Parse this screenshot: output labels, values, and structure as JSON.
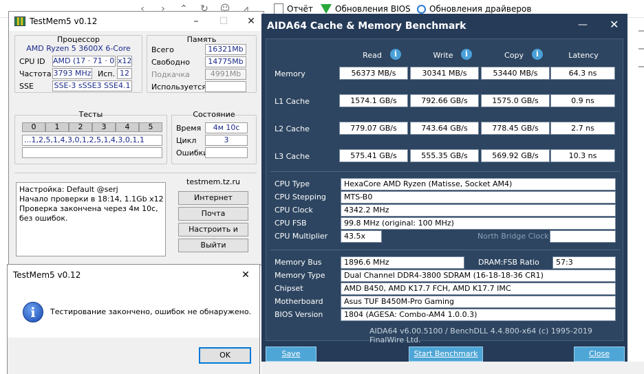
{
  "background_toolbar": {
    "report": "Отчёт",
    "bios_updates": "Обновления BIOS",
    "driver_updates": "Обновления драйверов"
  },
  "testmem": {
    "title": "TestMem5 v0.12",
    "processor_title": "Процессор",
    "cpu_name": "AMD Ryzen 5 3600X 6-Core",
    "cpu_id_label": "CPU ID",
    "cpu_id_value": "AMD  (17 · 71 · 0)",
    "cpu_threads": "x12",
    "freq_label": "Частота",
    "freq_value": "3793 MHz",
    "used_threads_label": "Исп.",
    "used_threads_value": "12",
    "sse_label": "SSE",
    "sse_value": "SSE-3 sSSE3 SSE4.1",
    "memory_title": "Память",
    "total_label": "Всего",
    "total_value": "16321Mb",
    "free_label": "Свободно",
    "free_value": "14775Mb",
    "swap_label": "Подкачка",
    "swap_value": "4991Mb",
    "used_label": "Используется",
    "used_value": "",
    "tests_title": "Тесты",
    "test_headers": [
      "0",
      "1",
      "2",
      "3",
      "4",
      "5"
    ],
    "test_sequence": "...1,2,5,1,4,3,0,1,2,5,1,4,3,0,1,1",
    "status_title": "Состояние",
    "time_label": "Время",
    "time_value": "4м 10с",
    "cycle_label": "Цикл",
    "cycle_value": "3",
    "errors_label": "Ошибки",
    "errors_value": "",
    "log": [
      "Настройка: Default @serj",
      "Начало проверки в 18:14, 1.1Gb x12",
      "Проверка закончена через 4м 10с,",
      "без ошибок."
    ],
    "site": "testmem.tz.ru",
    "btn_internet": "Интернет",
    "btn_mail": "Почта",
    "btn_config_exit": "Настроить и выйти",
    "btn_exit": "Выйти"
  },
  "dialog": {
    "title": "TestMem5 v0.12",
    "message": "Тестирование закончено, ошибок не обнаружено.",
    "ok": "OK"
  },
  "aida": {
    "title": "AIDA64 Cache & Memory Benchmark",
    "columns": [
      "Read",
      "Write",
      "Copy",
      "Latency"
    ],
    "rows": [
      {
        "label": "Memory",
        "values": [
          "56373 MB/s",
          "30341 MB/s",
          "53440 MB/s",
          "64.3 ns"
        ]
      },
      {
        "label": "L1 Cache",
        "values": [
          "1574.1 GB/s",
          "792.66 GB/s",
          "1575.0 GB/s",
          "0.9 ns"
        ]
      },
      {
        "label": "L2 Cache",
        "values": [
          "779.07 GB/s",
          "743.64 GB/s",
          "778.45 GB/s",
          "2.7 ns"
        ]
      },
      {
        "label": "L3 Cache",
        "values": [
          "575.41 GB/s",
          "555.35 GB/s",
          "569.92 GB/s",
          "10.3 ns"
        ]
      }
    ],
    "info1": [
      {
        "label": "CPU Type",
        "value": "HexaCore AMD Ryzen  (Matisse, Socket AM4)"
      },
      {
        "label": "CPU Stepping",
        "value": "MTS-B0"
      },
      {
        "label": "CPU Clock",
        "value": "4342.2 MHz"
      },
      {
        "label": "CPU FSB",
        "value": "99.8 MHz  (original: 100 MHz)"
      },
      {
        "label": "CPU Multiplier",
        "value": "43.5x"
      }
    ],
    "north_bridge_clock": "North Bridge Clock",
    "memory_bus_label": "Memory Bus",
    "memory_bus_value": "1896.6 MHz",
    "dram_fsb_label": "DRAM:FSB Ratio",
    "dram_fsb_value": "57:3",
    "info2": [
      {
        "label": "Memory Type",
        "value": "Dual Channel DDR4-3800 SDRAM  (16-18-18-36 CR1)"
      },
      {
        "label": "Chipset",
        "value": "AMD B450, AMD K17.7 FCH, AMD K17.7 IMC"
      },
      {
        "label": "Motherboard",
        "value": "Asus TUF B450M-Pro Gaming"
      },
      {
        "label": "BIOS Version",
        "value": "1804  (AGESA: Combo-AM4 1.0.0.3)"
      }
    ],
    "footer": "AIDA64 v6.00.5100 / BenchDLL 4.4.800-x64  (c) 1995-2019 FinalWire Ltd.",
    "btn_save": "Save",
    "btn_start": "Start Benchmark",
    "btn_close": "Close"
  }
}
